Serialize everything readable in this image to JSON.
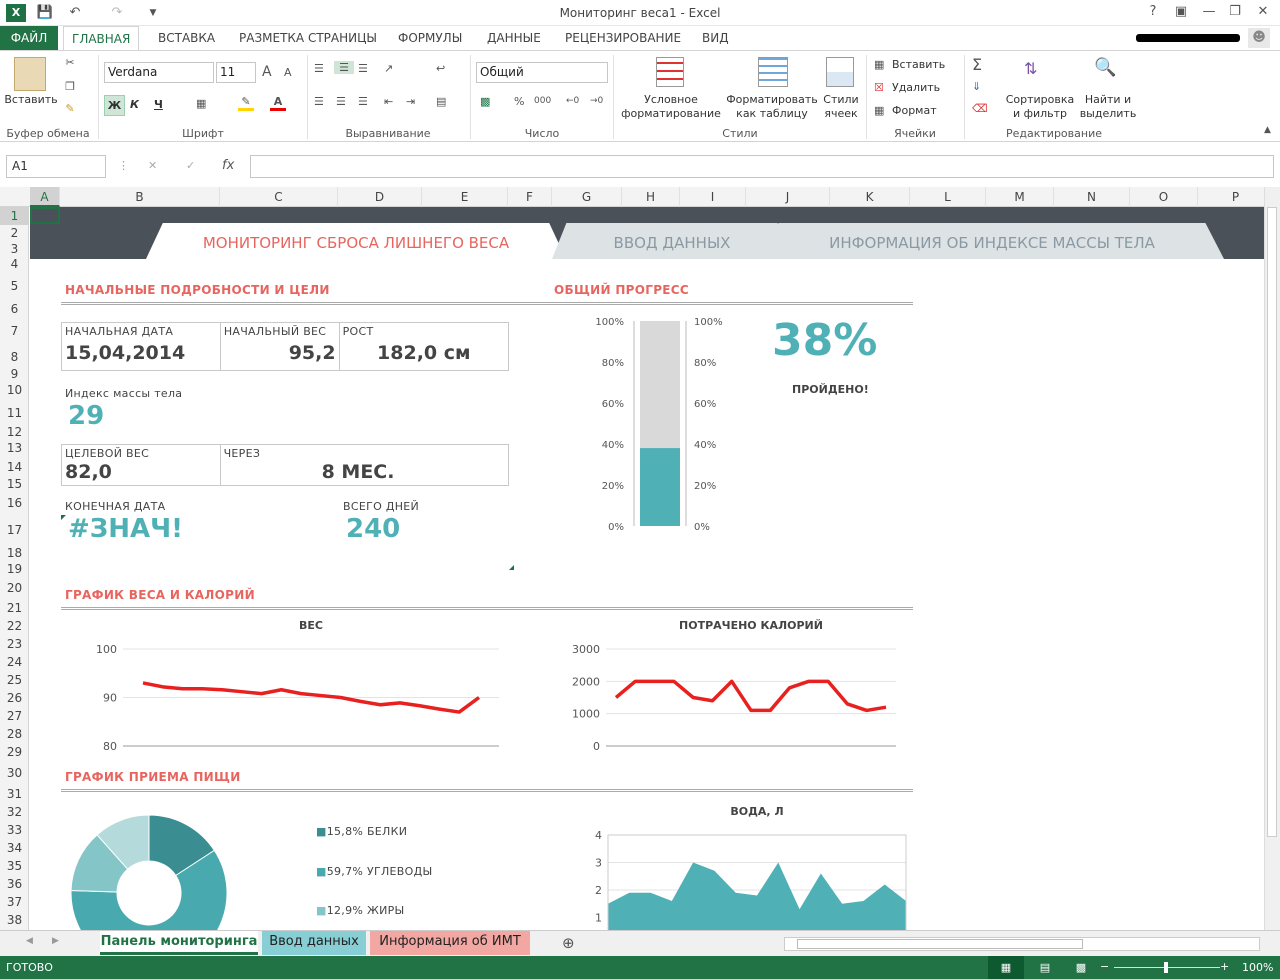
{
  "window": {
    "title": "Мониторинг веса1 - Excel"
  },
  "ribbon_tabs": [
    "ФАЙЛ",
    "ГЛАВНАЯ",
    "ВСТАВКА",
    "РАЗМЕТКА СТРАНИЦЫ",
    "ФОРМУЛЫ",
    "ДАННЫЕ",
    "РЕЦЕНЗИРОВАНИЕ",
    "ВИД"
  ],
  "clipboard": {
    "paste": "Вставить",
    "group": "Буфер обмена"
  },
  "font": {
    "name": "Verdana",
    "size": "11",
    "bold": "Ж",
    "italic": "К",
    "underline": "Ч",
    "group": "Шрифт"
  },
  "alignment": {
    "group": "Выравнивание"
  },
  "number": {
    "format": "Общий",
    "group": "Число"
  },
  "styles": {
    "conditional_1": "Условное",
    "conditional_2": "форматирование",
    "table_1": "Форматировать",
    "table_2": "как таблицу",
    "cell_1": "Стили",
    "cell_2": "ячеек",
    "group": "Стили"
  },
  "cells": {
    "insert": "Вставить",
    "delete": "Удалить",
    "format": "Формат",
    "group": "Ячейки"
  },
  "editing": {
    "sort_1": "Сортировка",
    "sort_2": "и фильтр",
    "find_1": "Найти и",
    "find_2": "выделить",
    "group": "Редактирование"
  },
  "formula_bar": {
    "name_box": "A1",
    "fx": "fx",
    "value": ""
  },
  "columns": [
    "A",
    "B",
    "C",
    "D",
    "E",
    "F",
    "G",
    "H",
    "I",
    "J",
    "K",
    "L",
    "M",
    "N",
    "O",
    "P"
  ],
  "rows": [
    "1",
    "2",
    "3",
    "4",
    "5",
    "6",
    "7",
    "8",
    "9",
    "10",
    "11",
    "12",
    "13",
    "14",
    "15",
    "16",
    "17",
    "18",
    "19",
    "20",
    "21",
    "22",
    "23",
    "24",
    "25",
    "26",
    "27",
    "28",
    "29",
    "30",
    "31",
    "32",
    "33",
    "34",
    "35",
    "36",
    "37",
    "38"
  ],
  "dashboard": {
    "tabs": [
      "МОНИТОРИНГ СБРОСА ЛИШНЕГО ВЕСА",
      "ВВОД ДАННЫХ",
      "ИНФОРМАЦИЯ ОБ ИНДЕКСЕ МАССЫ ТЕЛА"
    ],
    "details": {
      "section": "НАЧАЛЬНЫЕ ПОДРОБНОСТИ И ЦЕЛИ",
      "start_date_label": "НАЧАЛЬНАЯ ДАТА",
      "start_date": "15,04,2014",
      "start_weight_label": "НАЧАЛЬНЫЙ ВЕС",
      "start_weight": "95,2",
      "height_label": "РОСТ",
      "height": "182,0 см",
      "bmi_label": "Индекс массы тела",
      "bmi": "29",
      "target_label": "ЦЕЛЕВОЙ ВЕС",
      "target": "82,0",
      "through_label": "ЧЕРЕЗ",
      "through": "8 МЕС.",
      "end_label": "КОНЕЧНАЯ ДАТА",
      "end": "#ЗНАЧ!",
      "days_label": "ВСЕГО ДНЕЙ",
      "days": "240"
    },
    "progress": {
      "section": "ОБЩИЙ ПРОГРЕСС",
      "value": 0.38,
      "value_text": "38%",
      "caption": "ПРОЙДЕНО!",
      "ticks": [
        "100%",
        "80%",
        "60%",
        "40%",
        "20%",
        "0%"
      ]
    },
    "weight_section": "ГРАФИК ВЕСА И КАЛОРИЙ",
    "food_section": "ГРАФИК ПРИЕМА ПИЩИ",
    "legend": [
      "15,8% БЕЛКИ",
      "59,7% УГЛЕВОДЫ",
      "12,9% ЖИРЫ"
    ]
  },
  "chart_data": [
    {
      "type": "line",
      "title": "ВЕС",
      "ylim": [
        80,
        100
      ],
      "yticks": [
        "100",
        "90",
        "80"
      ],
      "color": "#e8201f",
      "x": [
        1,
        2,
        3,
        4,
        5,
        6,
        7,
        8,
        9,
        10,
        11,
        12,
        13,
        14,
        15,
        16,
        17,
        18,
        19,
        20,
        21
      ],
      "values": [
        93,
        92.2,
        91.8,
        91.8,
        91.6,
        91.2,
        90.8,
        91.6,
        90.8,
        90.4,
        90,
        89.2,
        88.5,
        88.9,
        88.3,
        87.6,
        87,
        90
      ]
    },
    {
      "type": "line",
      "title": "ПОТРАЧЕНО КАЛОРИЙ",
      "ylim": [
        0,
        3000
      ],
      "yticks": [
        "3000",
        "2000",
        "1000",
        "0"
      ],
      "color": "#e8201f",
      "values": [
        1500,
        2000,
        2000,
        2000,
        1500,
        1400,
        2000,
        1100,
        1100,
        1800,
        2000,
        2000,
        1300,
        1100,
        1200
      ]
    },
    {
      "type": "pie",
      "title": "",
      "slices": [
        {
          "label": "БЕЛКИ",
          "value": 15.8,
          "color": "#3a8e91"
        },
        {
          "label": "УГЛЕВОДЫ",
          "value": 59.7,
          "color": "#48a9ae"
        },
        {
          "label": "ЖИРЫ",
          "value": 12.9,
          "color": "#84c5c8"
        },
        {
          "label": "",
          "value": 11.6,
          "color": "#b4dadb"
        }
      ]
    },
    {
      "type": "area",
      "title": "ВОДА, Л",
      "ylim": [
        0,
        4
      ],
      "yticks": [
        "4",
        "3",
        "2",
        "1"
      ],
      "color": "#4fb0b6",
      "values": [
        1.5,
        1.9,
        1.9,
        1.6,
        3,
        2.7,
        1.9,
        1.8,
        3,
        1.3,
        2.6,
        1.5,
        1.6,
        2.2,
        1.6
      ]
    }
  ],
  "sheet_tabs": [
    "Панель мониторинга",
    "Ввод данных",
    "Информация об ИМТ"
  ],
  "status": {
    "ready": "ГОТОВО",
    "zoom": "100%"
  }
}
